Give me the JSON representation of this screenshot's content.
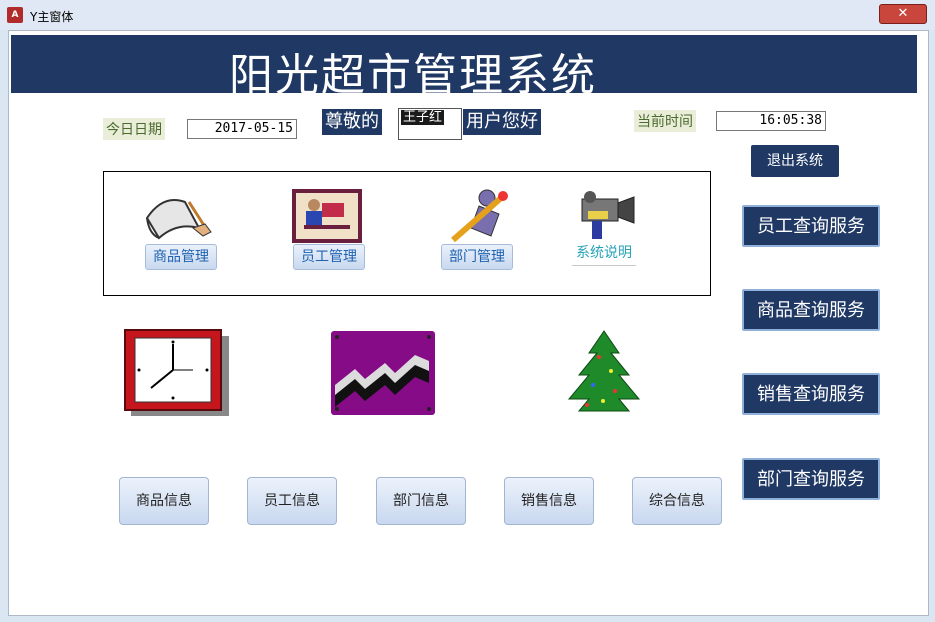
{
  "window": {
    "title": "Y主窗体",
    "close_symbol": "✕"
  },
  "header": {
    "title": "阳光超市管理系统"
  },
  "date": {
    "label": "今日日期",
    "value": "2017-05-15"
  },
  "greeting": {
    "prefix": "尊敬的",
    "user": "王子红",
    "suffix": "用户您好"
  },
  "time": {
    "label": "当前时间",
    "value": "16:05:38"
  },
  "exit_label": "退出系统",
  "modules": [
    {
      "label": "商品管理",
      "icon": "scroll-quill-icon"
    },
    {
      "label": "员工管理",
      "icon": "person-at-desk-icon"
    },
    {
      "label": "部门管理",
      "icon": "pencil-person-icon"
    },
    {
      "label": "系统说明",
      "icon": "camera-icon"
    }
  ],
  "decor_icons": [
    "clock-icon",
    "chart-trend-icon",
    "christmas-tree-icon"
  ],
  "services": [
    "员工查询服务",
    "商品查询服务",
    "销售查询服务",
    "部门查询服务"
  ],
  "info_buttons": [
    "商品信息",
    "员工信息",
    "部门信息",
    "销售信息",
    "综合信息"
  ],
  "colors": {
    "navy": "#1f3864",
    "button_text_blue": "#1e62b0"
  }
}
